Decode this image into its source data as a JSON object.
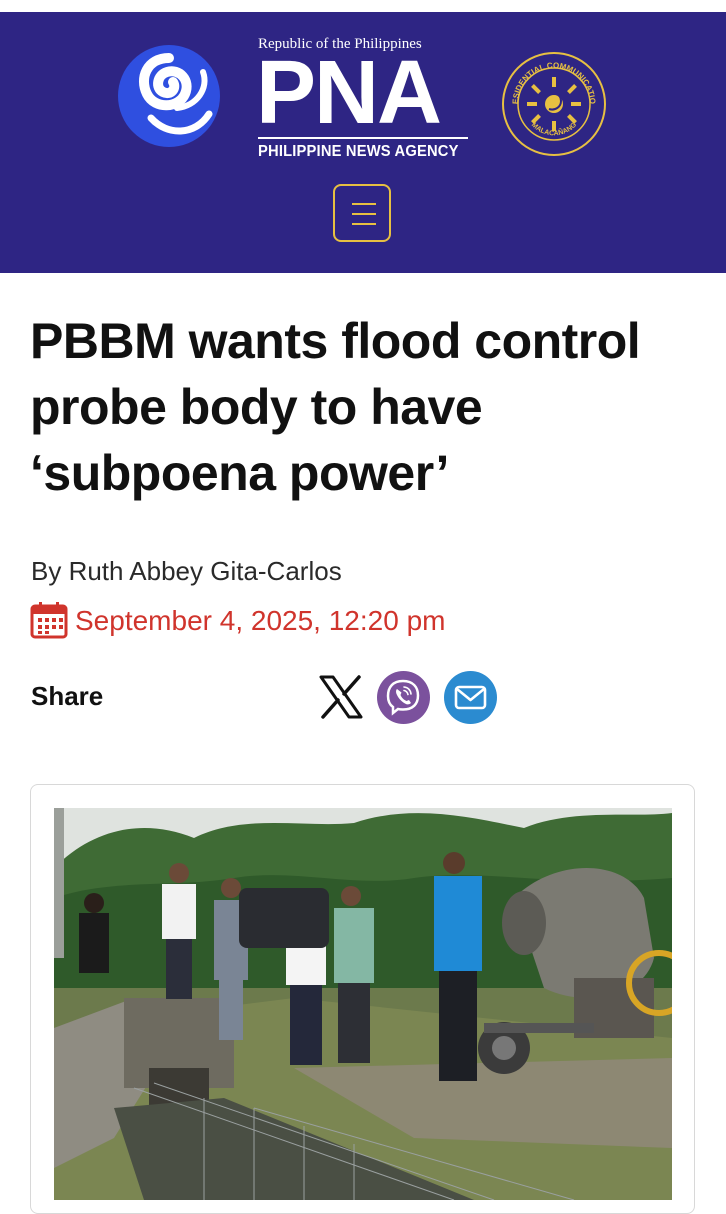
{
  "header": {
    "logo_top_line": "Republic of the Philippines",
    "logo_wordmark": "PNA",
    "logo_subtitle": "PHILIPPINE NEWS AGENCY",
    "seal_text_top": "PRESIDENTIAL COMMUNICATIONS",
    "seal_text_bottom": "MALACAÑANG",
    "menu_icon": "hamburger-menu-icon",
    "colors": {
      "background": "#2e2584",
      "accent": "#e7c042",
      "swirl_blue": "#2f4fe0"
    }
  },
  "article": {
    "headline": "PBBM wants flood control probe body to have ‘subpoena power’",
    "byline": "By Ruth Abbey Gita-Carlos",
    "date": "September 4, 2025, 12:20 pm",
    "date_icon": "calendar-icon",
    "date_color": "#d0342c"
  },
  "share": {
    "label": "Share",
    "buttons": [
      {
        "icon": "x-twitter-icon"
      },
      {
        "icon": "viber-icon",
        "color": "#7b519d"
      },
      {
        "icon": "email-icon",
        "color": "#2b8bd0"
      }
    ]
  },
  "photo": {
    "subject": "officials inspecting a drainage canal beside a cement mixer"
  }
}
